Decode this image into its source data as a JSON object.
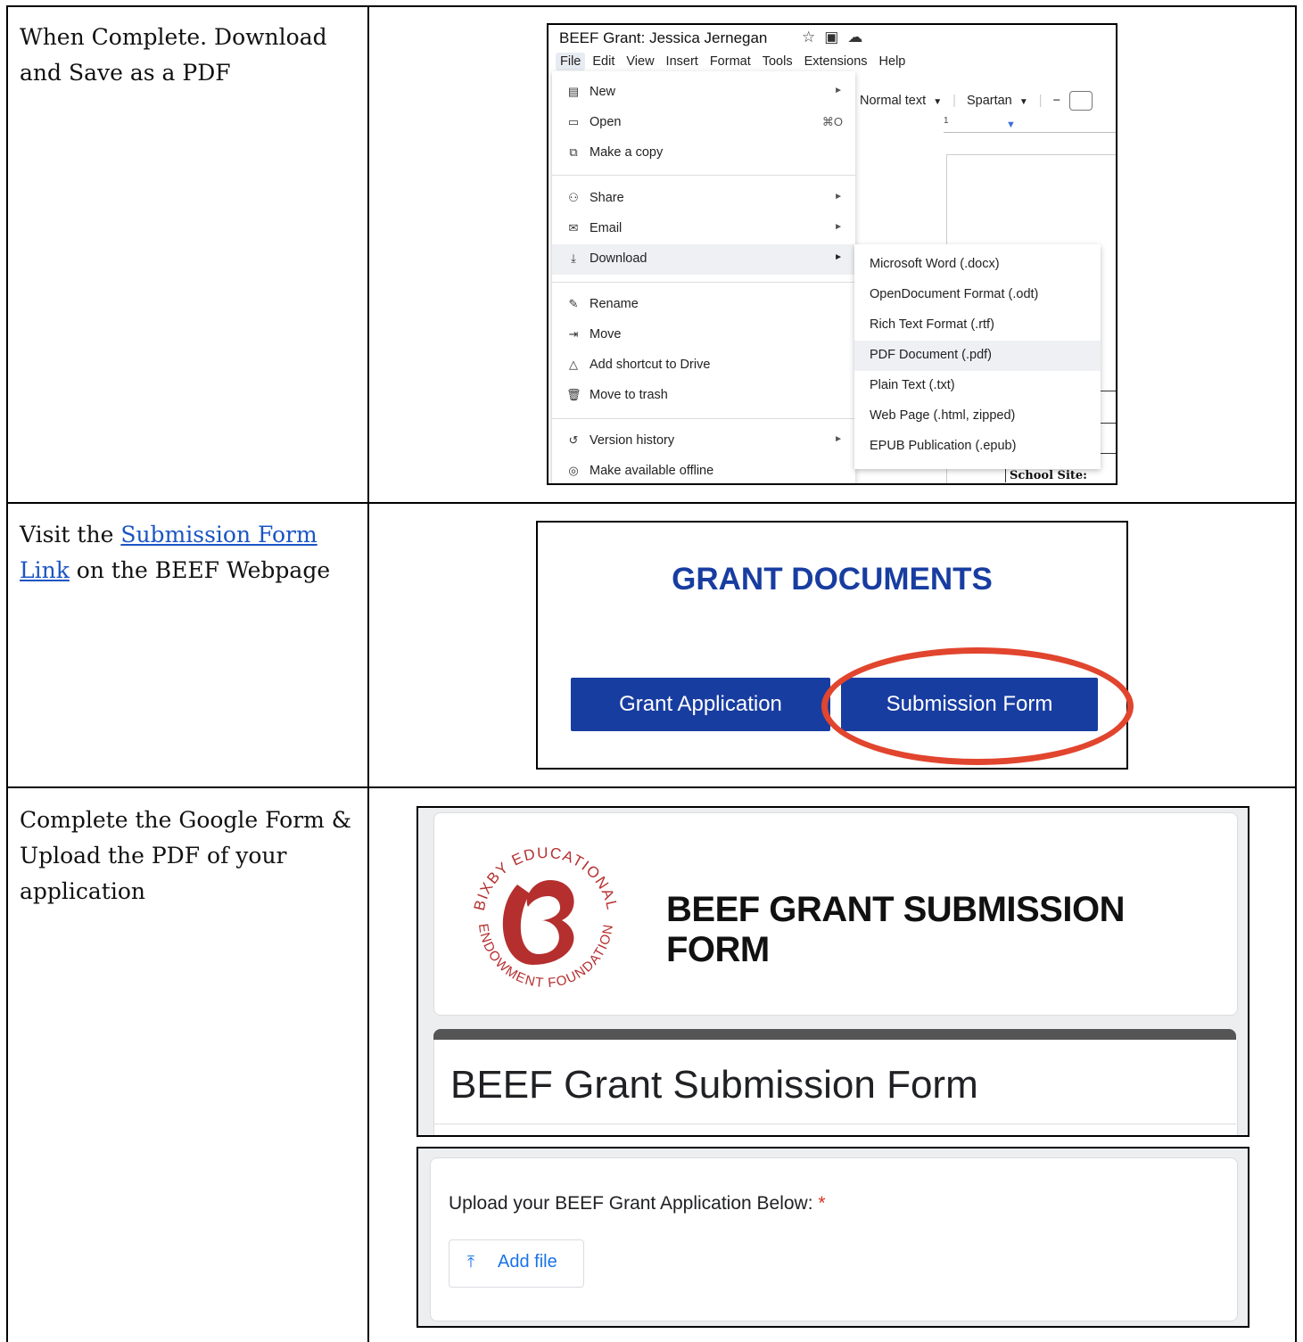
{
  "rows": [
    {
      "instruction": "When Complete. Download and Save as a PDF"
    },
    {
      "instruction_prefix": "Visit the ",
      "instruction_link": "Submission Form Link",
      "instruction_suffix": " on the BEEF Webpage"
    },
    {
      "instruction": "Complete the Google Form & Upload the PDF of your application"
    }
  ],
  "docs": {
    "title": "BEEF Grant: Jessica Jernegan",
    "menubar": [
      "File",
      "Edit",
      "View",
      "Insert",
      "Format",
      "Tools",
      "Extensions",
      "Help"
    ],
    "style_select": "Normal text",
    "font_select": "Spartan",
    "ruler_mark": "1",
    "school_site": "School Site:",
    "file_menu": [
      {
        "label": "New",
        "icon": "new-doc-icon",
        "glyph": "▤",
        "arrow": true
      },
      {
        "label": "Open",
        "icon": "folder-icon",
        "glyph": "▭",
        "shortcut": "⌘O"
      },
      {
        "label": "Make a copy",
        "icon": "copy-icon",
        "glyph": "⧉"
      },
      {
        "label": "Share",
        "icon": "share-icon",
        "glyph": "⚇",
        "arrow": true
      },
      {
        "label": "Email",
        "icon": "email-icon",
        "glyph": "✉",
        "arrow": true
      },
      {
        "label": "Download",
        "icon": "download-icon",
        "glyph": "⤓",
        "arrow": true,
        "highlighted": true
      },
      {
        "label": "Rename",
        "icon": "rename-icon",
        "glyph": "✎"
      },
      {
        "label": "Move",
        "icon": "move-icon",
        "glyph": "⇥"
      },
      {
        "label": "Add shortcut to Drive",
        "icon": "drive-shortcut-icon",
        "glyph": "△"
      },
      {
        "label": "Move to trash",
        "icon": "trash-icon",
        "glyph": "🗑"
      },
      {
        "label": "Version history",
        "icon": "history-icon",
        "glyph": "↺",
        "arrow": true
      },
      {
        "label": "Make available offline",
        "icon": "offline-icon",
        "glyph": "◎"
      }
    ],
    "download_submenu": [
      "Microsoft Word (.docx)",
      "OpenDocument Format (.odt)",
      "Rich Text Format (.rtf)",
      "PDF Document (.pdf)",
      "Plain Text (.txt)",
      "Web Page (.html, zipped)",
      "EPUB Publication (.epub)"
    ],
    "submenu_highlighted": "PDF Document (.pdf)"
  },
  "grant_docs": {
    "heading": "GRANT DOCUMENTS",
    "btn_application": "Grant Application",
    "btn_submission": "Submission Form",
    "accent_color": "#183da1",
    "circle_color": "#e1452e"
  },
  "form": {
    "logo_top_text": "BIXBY EDUCATIONAL",
    "logo_bottom_text": "ENDOWMENT FOUNDATION",
    "logo_color": "#b52f2f",
    "header_title": "BEEF GRANT SUBMISSION FORM",
    "form_title": "BEEF Grant Submission Form",
    "upload_label": "Upload your BEEF Grant Application Below:",
    "required_mark": "*",
    "add_file": "Add file"
  }
}
